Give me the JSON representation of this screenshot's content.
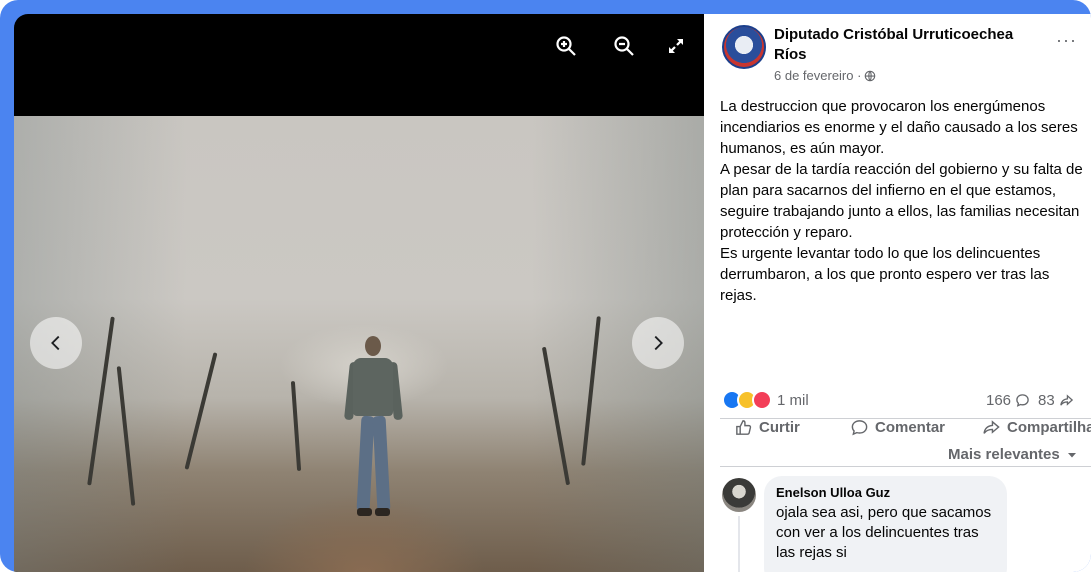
{
  "viewer": {
    "zoom_in_icon": "zoom-in-icon",
    "zoom_out_icon": "zoom-out-icon",
    "fullscreen_icon": "fullscreen-icon",
    "prev_icon": "chevron-left-icon",
    "next_icon": "chevron-right-icon"
  },
  "post": {
    "author": "Diputado Cristóbal Urruticoechea Ríos",
    "date": "6 de fevereiro ·",
    "privacy_icon": "globe-icon",
    "more_label": "···",
    "text": [
      "La destruccion que provocaron los energúmenos incendiarios es enorme y el daño causado a los seres humanos, es aún mayor.",
      "A pesar de la tardía reacción del gobierno y su falta de plan para sacarnos del infierno en el que estamos, seguire trabajando junto a ellos, las familias necesitan protección y reparo.",
      "Es urgente levantar todo lo que los delincuentes derrumbaron, a los que pronto espero ver tras las rejas."
    ]
  },
  "reactions": {
    "count": "1 mil",
    "comments": "166",
    "shares": "83",
    "types": [
      "like",
      "haha",
      "love"
    ]
  },
  "actions": {
    "like": "Curtir",
    "comment": "Comentar",
    "share": "Compartilhar"
  },
  "comments": {
    "sort_label": "Mais relevantes",
    "items": [
      {
        "name": "Enelson Ulloa Guz",
        "text": "ojala sea asi, pero que sacamos con ver a los delincuentes tras las rejas si"
      }
    ]
  },
  "colors": {
    "frame": "#4b84f0",
    "like": "#1877f2",
    "haha": "#f7c12a",
    "love": "#f33e58",
    "muted_text": "#65676b"
  }
}
